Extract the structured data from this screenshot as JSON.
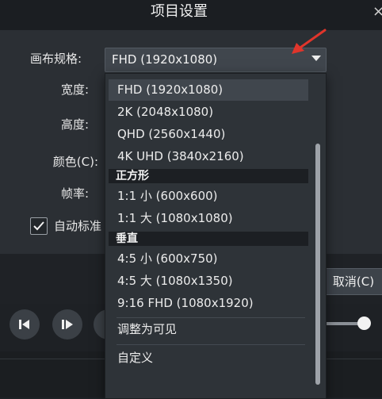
{
  "window": {
    "title": "项目设置",
    "close": "×"
  },
  "form": {
    "canvas_label": "画布规格:",
    "canvas_value": "FHD (1920x1080)",
    "width_label": "宽度:",
    "height_label": "高度:",
    "color_label": "颜色(C):",
    "fps_label": "帧率:",
    "auto_label": "自动标准",
    "cancel_label": "取消(C)"
  },
  "dropdown": {
    "options": [
      "FHD (1920x1080)",
      "2K (2048x1080)",
      "QHD (2560x1440)",
      "4K UHD (3840x2160)"
    ],
    "group_square": "正方形",
    "square_options": [
      "1:1 小 (600x600)",
      "1:1 大 (1080x1080)"
    ],
    "group_vertical": "垂直",
    "vertical_options": [
      "4:5 小 (600x750)",
      "4:5 大 (1080x1350)",
      "9:16 FHD (1080x1920)"
    ],
    "fit_visible": "调整为可见",
    "custom": "自定义"
  },
  "colors": {
    "annotation_arrow": "#e0352b",
    "dropdown_bg": "#2e3338",
    "selected_bg": "#40464d"
  },
  "icons": {
    "prev": "step-back-icon",
    "play": "step-forward-icon",
    "check": "check-icon",
    "dropdown": "chevron-down-icon"
  }
}
